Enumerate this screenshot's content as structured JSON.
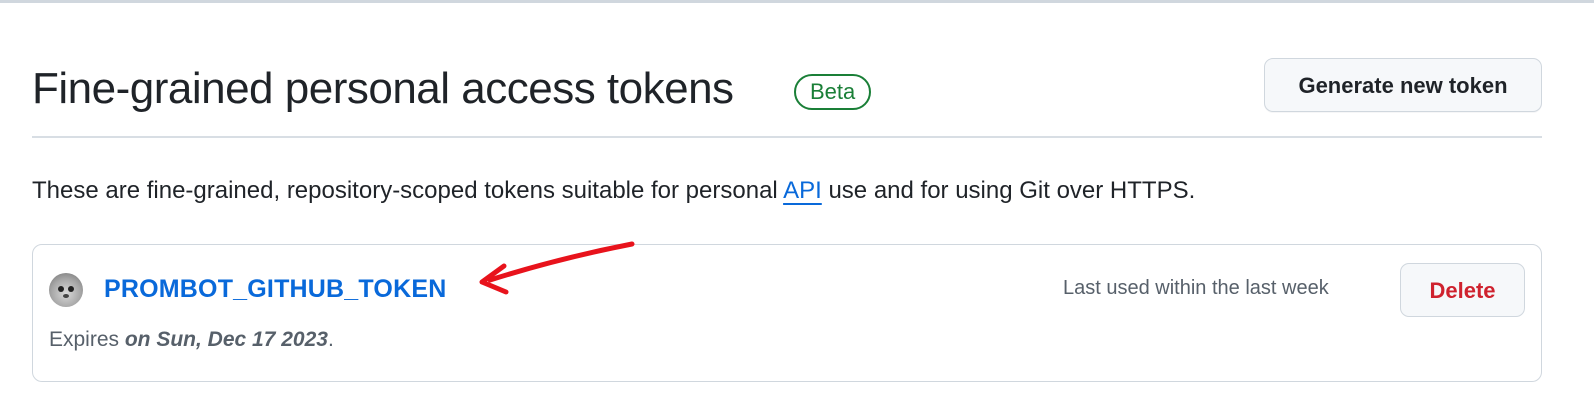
{
  "header": {
    "title": "Fine-grained personal access tokens",
    "badge": "Beta",
    "generate_button_label": "Generate new token"
  },
  "description": {
    "before_link": "These are fine-grained, repository-scoped tokens suitable for personal ",
    "link_text": "API",
    "after_link": " use and for using Git over HTTPS."
  },
  "token": {
    "name": "PROMBOT_GITHUB_TOKEN",
    "last_used": "Last used within the last week",
    "delete_label": "Delete",
    "expires_prefix": "Expires ",
    "expires_date": "on Sun, Dec 17 2023",
    "expires_suffix": "."
  },
  "colors": {
    "link": "#0969da",
    "beta_green": "#1a7f37",
    "delete_red": "#cf222e",
    "annotation_red": "#e8131c",
    "muted_text": "#57606a"
  },
  "icons": {
    "avatar": "avatar-image",
    "annotation": "red-arrow-icon"
  }
}
